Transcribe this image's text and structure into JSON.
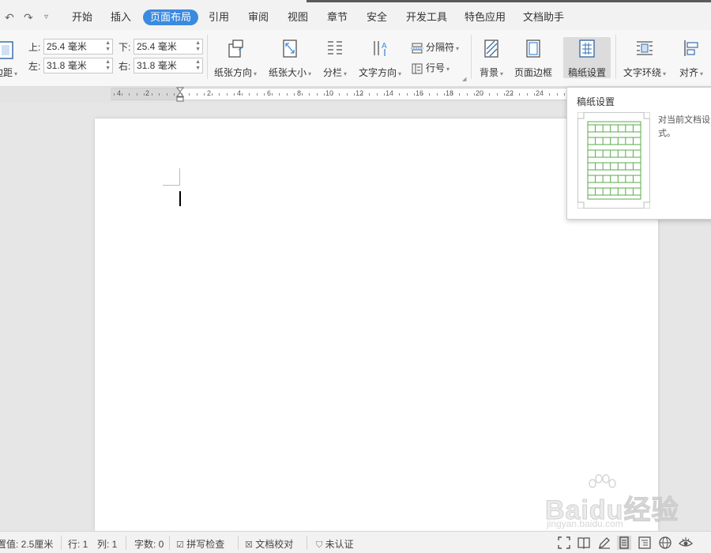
{
  "menu": {
    "items": [
      "开始",
      "插入",
      "页面布局",
      "引用",
      "审阅",
      "视图",
      "章节",
      "安全",
      "开发工具",
      "特色应用",
      "文档助手"
    ],
    "active_index": 2
  },
  "ribbon": {
    "margins_label_partial": "边距",
    "margin_top_label": "上:",
    "margin_top_value": "25.4 毫米",
    "margin_bottom_label": "下:",
    "margin_bottom_value": "25.4 毫米",
    "margin_left_label": "左:",
    "margin_left_value": "31.8 毫米",
    "margin_right_label": "右:",
    "margin_right_value": "31.8 毫米",
    "orientation": "纸张方向",
    "size": "纸张大小",
    "columns": "分栏",
    "text_direction": "文字方向",
    "separator": "分隔符",
    "line_number": "行号",
    "background": "背景",
    "page_border": "页面边框",
    "grid_paper": "稿纸设置",
    "text_wrap": "文字环绕",
    "align": "对齐"
  },
  "ruler": {
    "labels": [
      "4",
      "2",
      "2",
      "4",
      "6",
      "8",
      "10",
      "12",
      "14",
      "16",
      "18",
      "20",
      "22",
      "24"
    ]
  },
  "tooltip": {
    "title": "稿纸设置",
    "desc_line1": "对当前文档设",
    "desc_line2": "式。"
  },
  "status": {
    "setting_value": "置值: 2.5厘米",
    "line": "行: 1",
    "column": "列: 1",
    "word_count": "字数: 0",
    "spell_check": "拼写检查",
    "doc_proof": "文档校对",
    "uncertified": "未认证"
  },
  "watermark": {
    "brand": "Baidu经验",
    "url": "jingyan.baidu.com"
  },
  "colors": {
    "accent": "#3b8ae0",
    "grid_green": "#5aa84a"
  }
}
